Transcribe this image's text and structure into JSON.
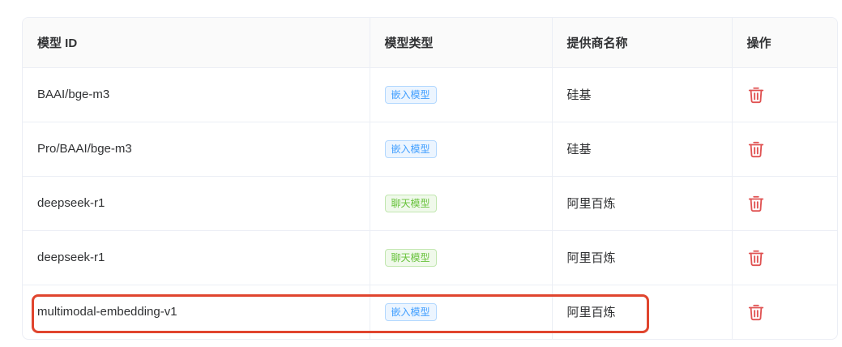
{
  "table": {
    "headers": {
      "model_id": "模型 ID",
      "model_type": "模型类型",
      "provider": "提供商名称",
      "actions": "操作"
    },
    "rows": [
      {
        "model_id": "BAAI/bge-m3",
        "model_type": "嵌入模型",
        "type_kind": "embed",
        "provider": "硅基"
      },
      {
        "model_id": "Pro/BAAI/bge-m3",
        "model_type": "嵌入模型",
        "type_kind": "embed",
        "provider": "硅基"
      },
      {
        "model_id": "deepseek-r1",
        "model_type": "聊天模型",
        "type_kind": "chat",
        "provider": "阿里百炼"
      },
      {
        "model_id": "deepseek-r1",
        "model_type": "聊天模型",
        "type_kind": "chat",
        "provider": "阿里百炼"
      },
      {
        "model_id": "multimodal-embedding-v1",
        "model_type": "嵌入模型",
        "type_kind": "embed",
        "provider": "阿里百炼"
      }
    ]
  },
  "colors": {
    "delete_icon": "#e05252",
    "highlight_border": "#e0452e",
    "embed_tag": "#409eff",
    "chat_tag": "#67c23a"
  },
  "icons": {
    "delete": "trash-icon"
  },
  "highlighted_row": 4
}
